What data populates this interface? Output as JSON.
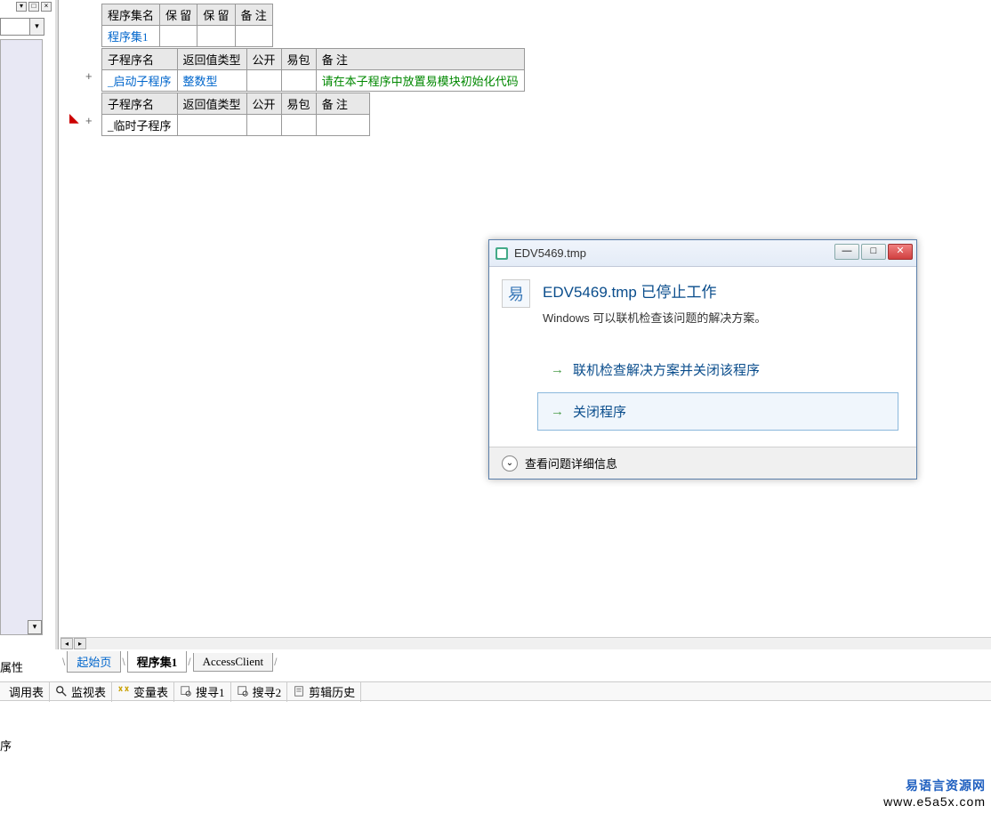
{
  "leftPanel": {
    "propsLabel": "属性"
  },
  "tables": {
    "t1": {
      "headers": [
        "程序集名",
        "保 留",
        "保 留",
        "备 注"
      ],
      "row": [
        "程序集1",
        "",
        "",
        ""
      ]
    },
    "t2": {
      "headers": [
        "子程序名",
        "返回值类型",
        "公开",
        "易包",
        "备 注"
      ],
      "row": [
        "_启动子程序",
        "整数型",
        "",
        "",
        "请在本子程序中放置易模块初始化代码"
      ]
    },
    "t3": {
      "headers": [
        "子程序名",
        "返回值类型",
        "公开",
        "易包",
        "备 注"
      ],
      "row": [
        "_临时子程序",
        "",
        "",
        "",
        ""
      ]
    }
  },
  "editorTabs": {
    "tab1": "起始页",
    "tab2": "程序集1",
    "tab3": "AccessClient"
  },
  "bottomBar": {
    "item1": "调用表",
    "item2": "监视表",
    "item3": "变量表",
    "item4": "搜寻1",
    "item5": "搜寻2",
    "item6": "剪辑历史"
  },
  "statusText": "序",
  "dialog": {
    "title": "EDV5469.tmp",
    "heading": "EDV5469.tmp 已停止工作",
    "subtext": "Windows 可以联机检查该问题的解决方案。",
    "option1": "联机检查解决方案并关闭该程序",
    "option2": "关闭程序",
    "details": "查看问题详细信息"
  },
  "watermark": {
    "line1": "易语言资源网",
    "line2": "www.e5a5x.com"
  }
}
